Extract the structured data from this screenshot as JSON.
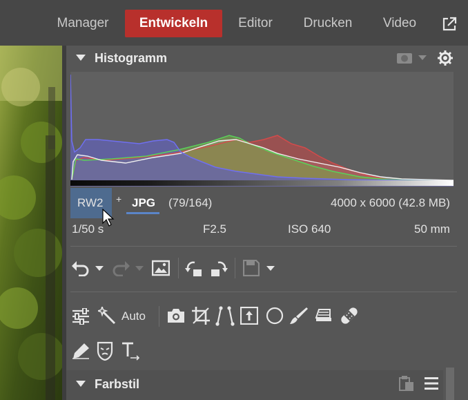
{
  "nav": {
    "items": [
      {
        "label": "Manager",
        "active": false
      },
      {
        "label": "Entwickeln",
        "active": true
      },
      {
        "label": "Editor",
        "active": false
      },
      {
        "label": "Drucken",
        "active": false
      },
      {
        "label": "Video",
        "active": false
      }
    ],
    "external_icon": "external-link-icon"
  },
  "histogram": {
    "title": "Histogramm",
    "icons": [
      "camera-shape-icon",
      "chevron-down-icon",
      "gear-icon"
    ]
  },
  "file_info": {
    "raw_format": "RW2",
    "plus": "+",
    "jpg_format": "JPG",
    "counter": "(79/164)",
    "dimensions": "4000 x 6000 (42.8 MB)",
    "shutter": "1/50 s",
    "aperture": "F2.5",
    "iso": "ISO 640",
    "focal": "50 mm"
  },
  "toolbar_row1": {
    "icons": [
      "undo-icon",
      "chevron-down-icon",
      "redo-icon",
      "chevron-down-icon",
      "image-icon",
      "rotate-left-icon",
      "rotate-right-icon",
      "save-icon",
      "chevron-down-icon"
    ]
  },
  "toolbar_row2": {
    "auto_label": "Auto",
    "icons": [
      "sliders-icon",
      "magic-wand-icon",
      "camera-icon",
      "crop-icon",
      "perspective-icon",
      "exposure-box-icon",
      "circle-icon",
      "brush-icon",
      "eraser-icon",
      "bandage-icon"
    ]
  },
  "toolbar_row3": {
    "icons": [
      "pencil-icon",
      "mask-icon",
      "text-icon"
    ]
  },
  "farbstil": {
    "title": "Farbstil",
    "icons": [
      "clipboard-icon",
      "menu-icon"
    ]
  },
  "colors": {
    "active_tab": "#b8302c",
    "selected_format": "#4e6b8f",
    "jpg_underline": "#5b85c8",
    "panel_bg": "#565656"
  }
}
